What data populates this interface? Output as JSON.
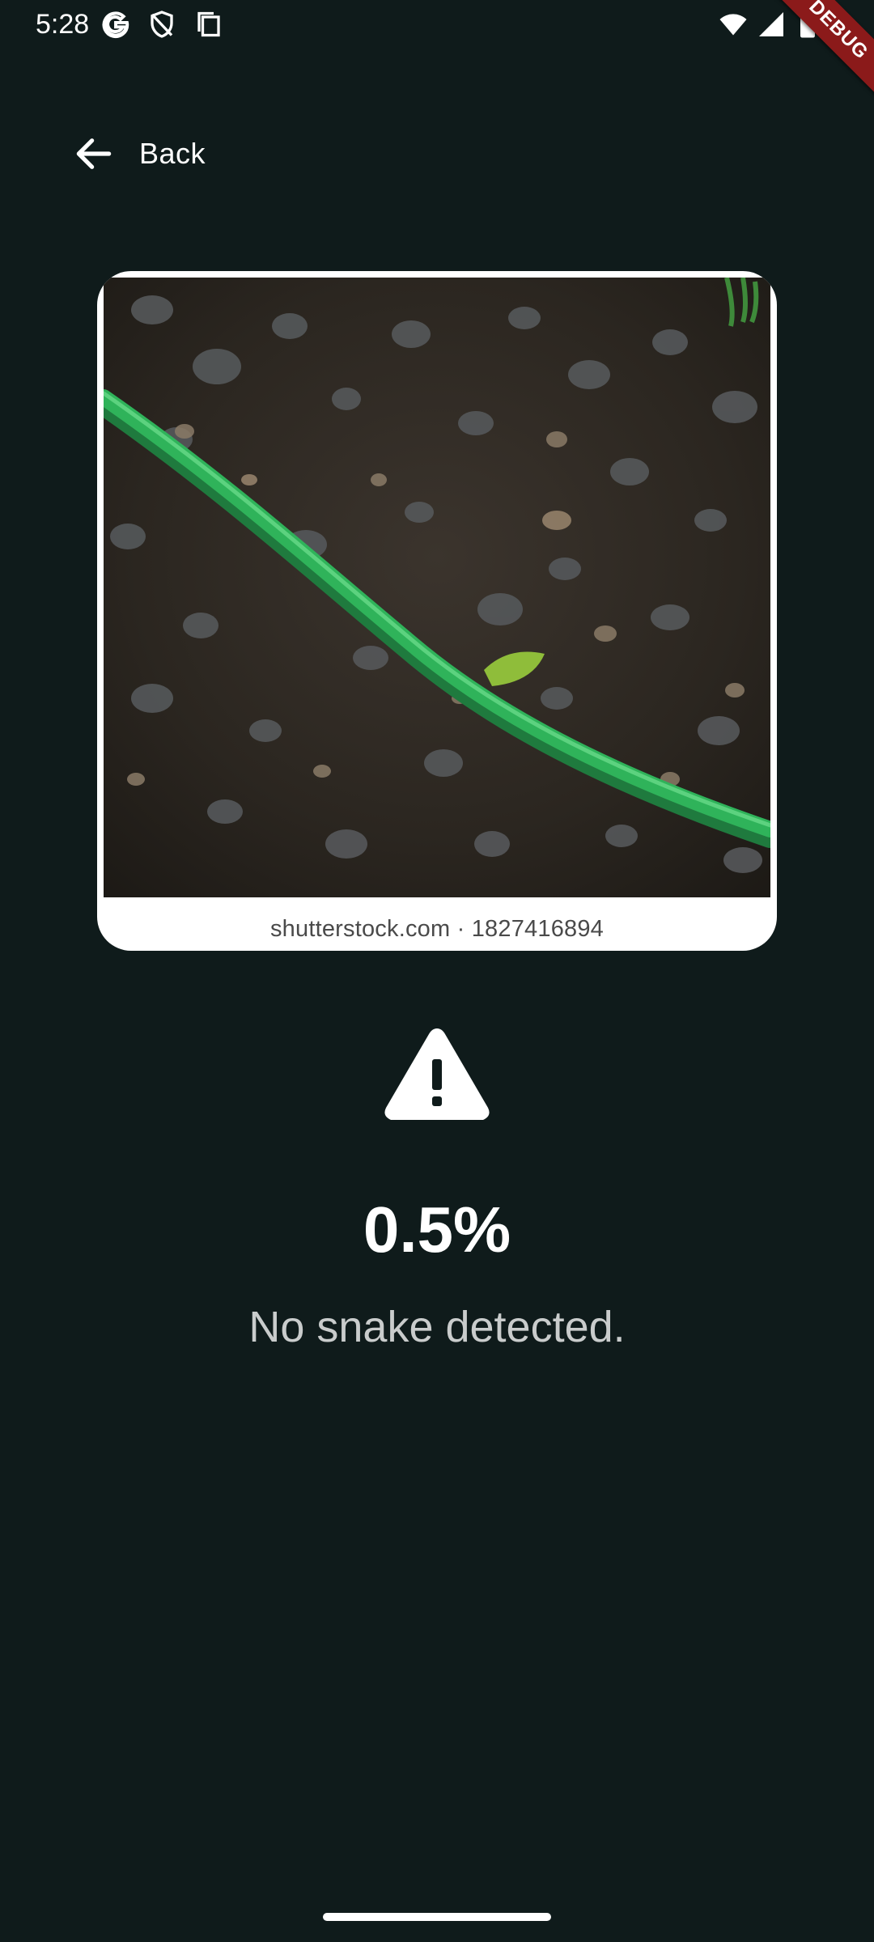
{
  "status_bar": {
    "time": "5:28",
    "left_icons": [
      "google-icon",
      "shield-icon",
      "clipboard-icon"
    ],
    "right_icons": [
      "wifi-icon",
      "signal-icon",
      "battery-icon"
    ]
  },
  "debug_banner": {
    "label": "DEBUG",
    "color": "#8b1a1a"
  },
  "header": {
    "back_label": "Back",
    "back_icon": "arrow-left-icon"
  },
  "photo": {
    "watermark": "shutterstock.com · 1827416894",
    "description_icon": "photo"
  },
  "result": {
    "icon": "warning-icon",
    "percentage": "0.5%",
    "message": "No snake detected."
  },
  "colors": {
    "background": "#0f1b1b",
    "text_primary": "#ffffff",
    "text_secondary": "#c9cccc",
    "hose": "#2fb35a"
  }
}
